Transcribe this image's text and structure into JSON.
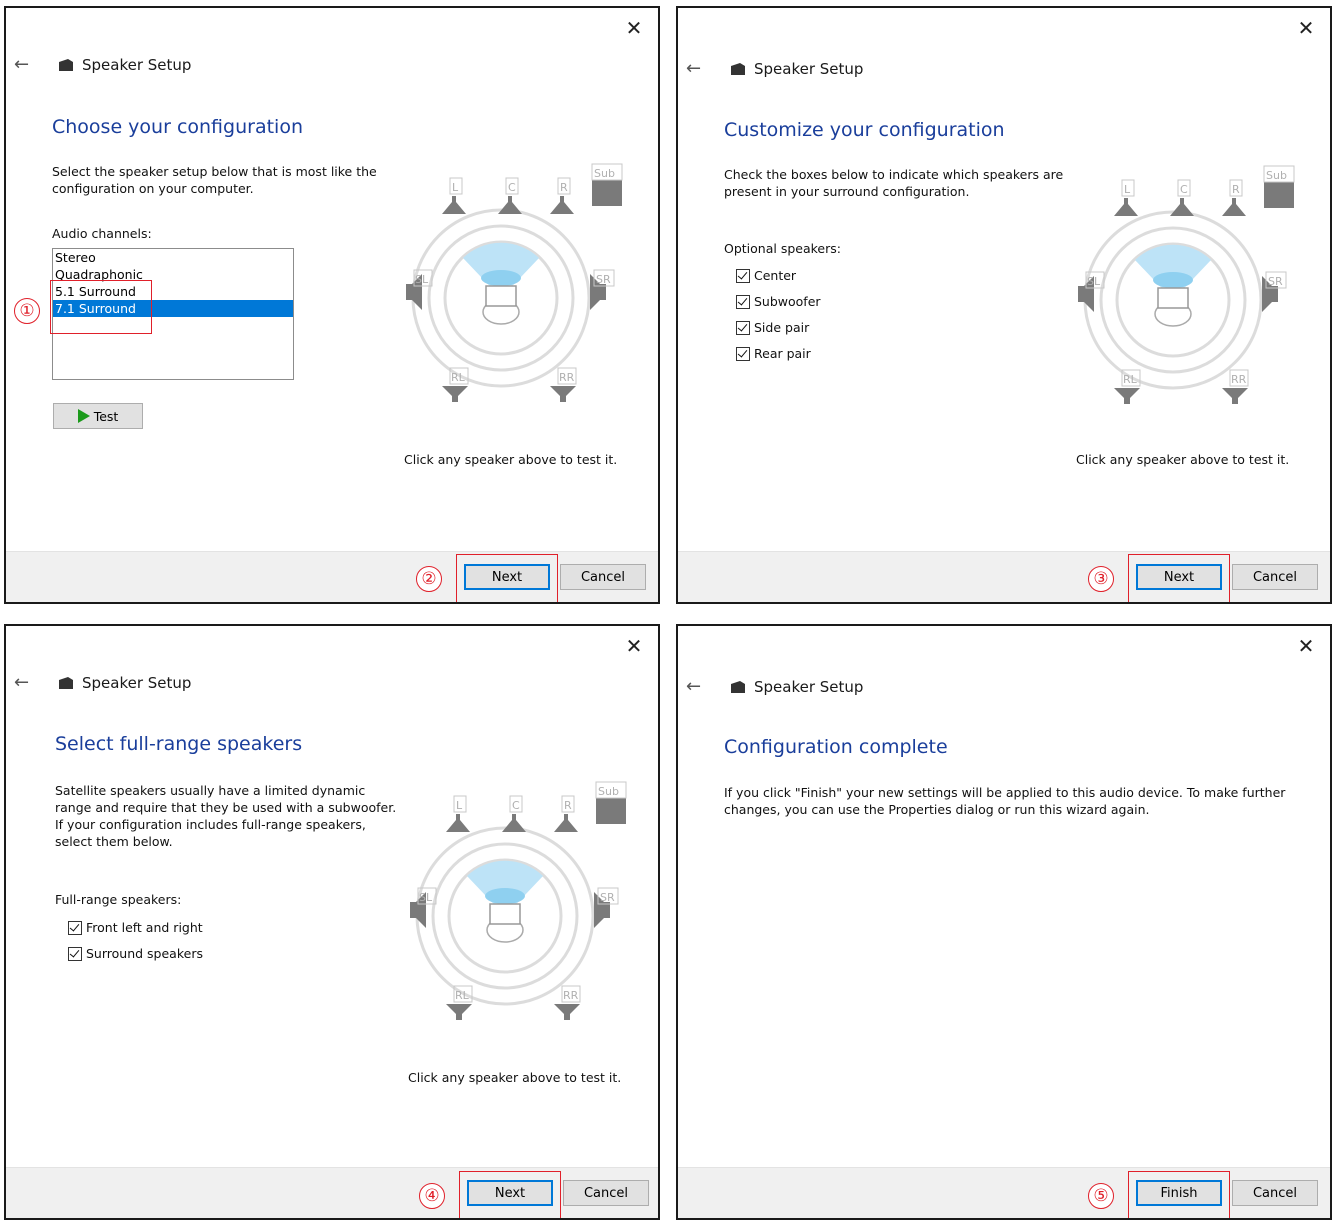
{
  "common": {
    "app_title": "Speaker Setup",
    "close_glyph": "✕",
    "back_glyph": "←",
    "hint": "Click any speaker above to test it.",
    "cancel": "Cancel",
    "speakers": {
      "L": "L",
      "C": "C",
      "R": "R",
      "Sub": "Sub",
      "SL": "SL",
      "SR": "SR",
      "RL": "RL",
      "RR": "RR"
    }
  },
  "panel1": {
    "heading": "Choose your configuration",
    "desc_line1": "Select the speaker setup below that is most like the",
    "desc_line2": "configuration on your computer.",
    "channels_label": "Audio channels:",
    "channels": [
      "Stereo",
      "Quadraphonic",
      "5.1 Surround",
      "7.1 Surround"
    ],
    "selected_channel": "7.1 Surround",
    "test_label": "Test",
    "next": "Next",
    "step_marks": [
      "①",
      "②"
    ]
  },
  "panel2": {
    "heading": "Customize your configuration",
    "desc_line1": "Check the boxes below to indicate which speakers are",
    "desc_line2": "present in your surround configuration.",
    "optional_label": "Optional speakers:",
    "options": [
      {
        "label": "Center",
        "checked": true
      },
      {
        "label": "Subwoofer",
        "checked": true
      },
      {
        "label": "Side pair",
        "checked": true
      },
      {
        "label": "Rear pair",
        "checked": true
      }
    ],
    "next": "Next",
    "step_mark": "③"
  },
  "panel3": {
    "heading": "Select full-range speakers",
    "desc_line1": "Satellite speakers usually have a limited dynamic",
    "desc_line2": "range and require that they be used with a subwoofer.",
    "desc_line3": "If your configuration includes full-range speakers,",
    "desc_line4": "select them below.",
    "fullrange_label": "Full-range speakers:",
    "options": [
      {
        "label": "Front left and right",
        "checked": true
      },
      {
        "label": "Surround speakers",
        "checked": true
      }
    ],
    "next": "Next",
    "step_mark": "④"
  },
  "panel4": {
    "heading": "Configuration complete",
    "desc_line1": "If you click \"Finish\" your new settings will be applied to this audio device.  To make further",
    "desc_line2": "changes, you can use the Properties dialog or run this wizard again.",
    "finish": "Finish",
    "step_mark": "⑤"
  }
}
